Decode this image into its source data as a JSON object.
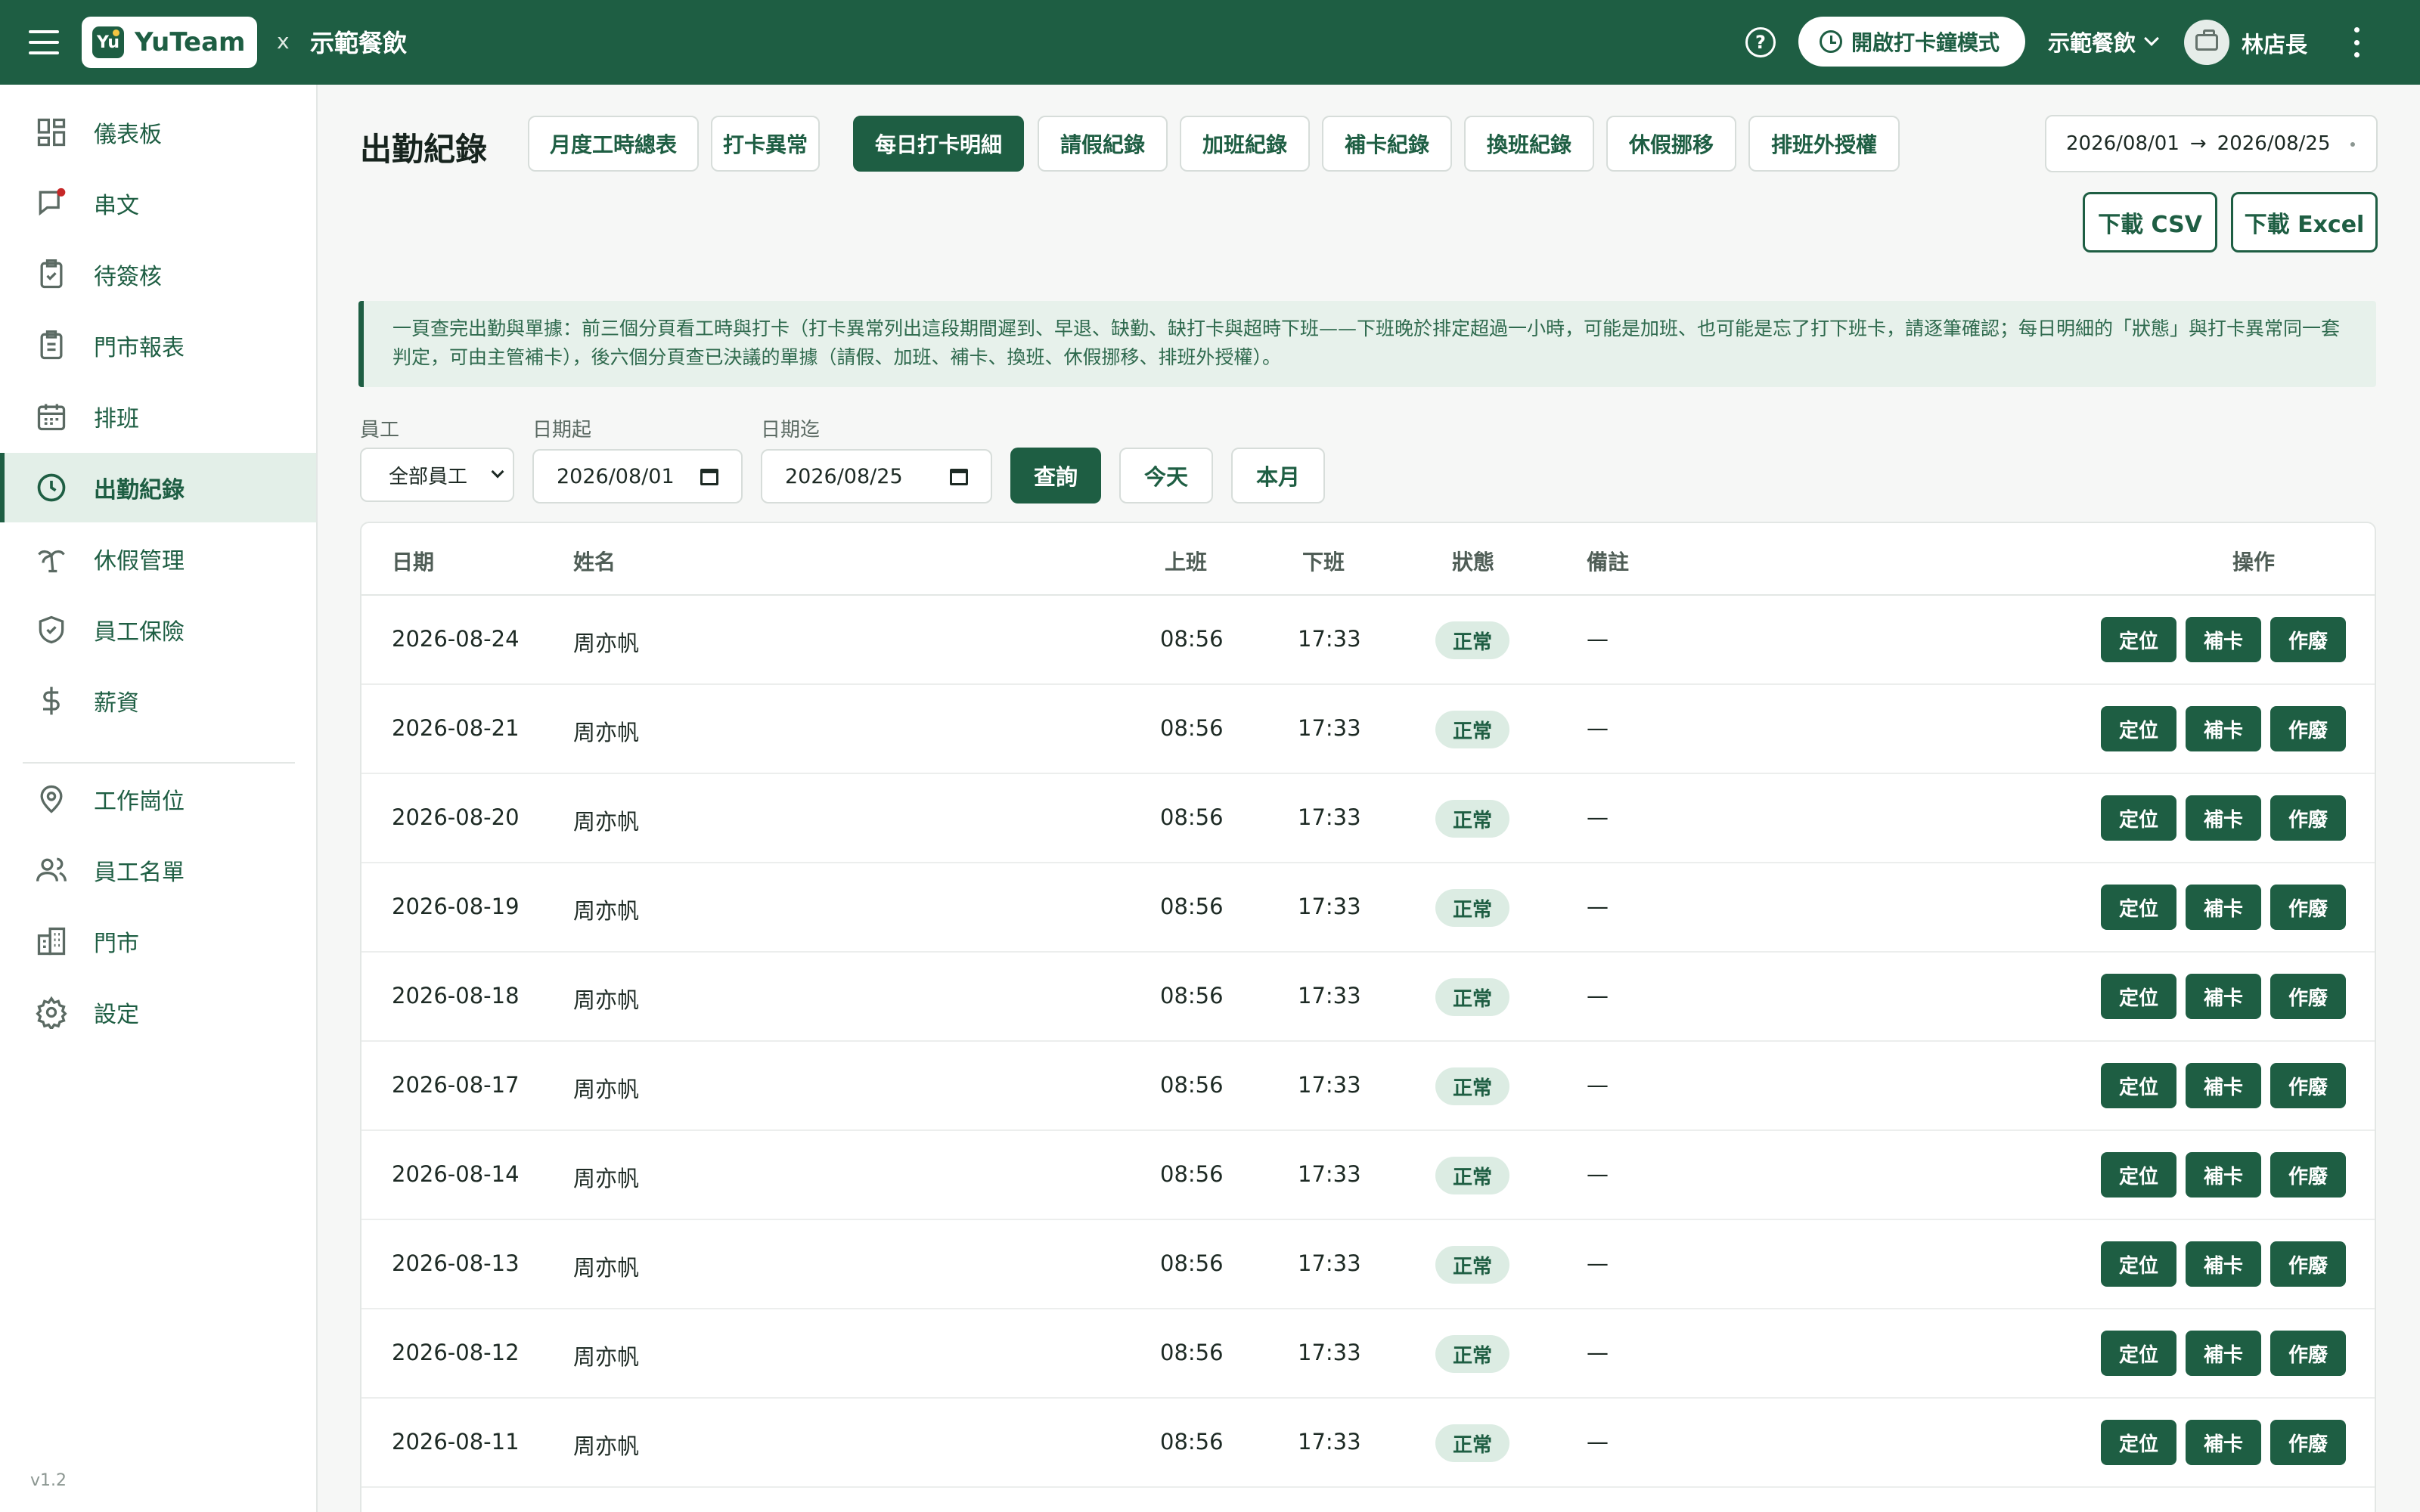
{
  "topbar": {
    "logo_text": "YuTeam",
    "logo_mark": "Yu",
    "separator": "x",
    "org_name": "示範餐飲",
    "clock_mode_label": "開啟打卡鐘模式",
    "org_select_value": "示範餐飲",
    "user_name": "林店長",
    "icons": [
      "menu-icon",
      "help-icon",
      "clock-icon",
      "chevron-down-icon",
      "briefcase-icon",
      "more-vertical-icon"
    ]
  },
  "sidebar": {
    "items": [
      {
        "label": "儀表板",
        "icon": "dashboard-icon"
      },
      {
        "label": "串文",
        "icon": "chat-icon"
      },
      {
        "label": "待簽核",
        "icon": "clipboard-check-icon"
      },
      {
        "label": "門市報表",
        "icon": "report-icon"
      },
      {
        "label": "排班",
        "icon": "calendar-icon"
      },
      {
        "label": "出勤紀錄",
        "icon": "clock-icon",
        "active": true
      },
      {
        "label": "休假管理",
        "icon": "palm-tree-icon"
      },
      {
        "label": "員工保險",
        "icon": "shield-check-icon"
      },
      {
        "label": "薪資",
        "icon": "dollar-icon"
      },
      {
        "label": "工作崗位",
        "icon": "map-pin-icon"
      },
      {
        "label": "員工名單",
        "icon": "users-icon"
      },
      {
        "label": "門市",
        "icon": "building-icon"
      },
      {
        "label": "設定",
        "icon": "gear-icon"
      }
    ],
    "version": "v1.2"
  },
  "main": {
    "title": "出勤紀錄",
    "tabs": [
      {
        "label": "月度工時總表"
      },
      {
        "label": "打卡異常"
      },
      {
        "label": "每日打卡明細",
        "active": true
      },
      {
        "label": "請假紀錄"
      },
      {
        "label": "加班紀錄"
      },
      {
        "label": "補卡紀錄"
      },
      {
        "label": "換班紀錄"
      },
      {
        "label": "休假挪移"
      },
      {
        "label": "排班外授權"
      }
    ],
    "date_range": {
      "from": "2026/08/01",
      "arrow": "→",
      "to": "2026/08/25"
    },
    "download_csv": "下載 CSV",
    "download_excel": "下載 Excel",
    "notice": "一頁查完出勤與單據：前三個分頁看工時與打卡（打卡異常列出這段期間遲到、早退、缺勤、缺打卡與超時下班——下班晚於排定超過一小時，可能是加班、也可能是忘了打下班卡，請逐筆確認；每日明細的「狀態」與打卡異常同一套判定，可由主管補卡），後六個分頁查已決議的單據（請假、加班、補卡、換班、休假挪移、排班外授權）。",
    "filters": {
      "employee_label": "員工",
      "employee_value": "全部員工",
      "date_from_label": "日期起",
      "date_from_value": "2026/08/01",
      "date_to_label": "日期迄",
      "date_to_value": "2026/08/25",
      "query_btn": "查詢",
      "today_btn": "今天",
      "month_btn": "本月"
    },
    "table": {
      "columns": {
        "date": "日期",
        "name": "姓名",
        "clock_in": "上班",
        "clock_out": "下班",
        "status": "狀態",
        "note": "備註",
        "actions": "操作"
      },
      "action_labels": {
        "locate": "定位",
        "makeup": "補卡",
        "void": "作廢"
      },
      "rows": [
        {
          "date": "2026-08-24",
          "name": "周亦帆",
          "in": "08:56",
          "out": "17:33",
          "status": "正常",
          "note": "—"
        },
        {
          "date": "2026-08-21",
          "name": "周亦帆",
          "in": "08:56",
          "out": "17:33",
          "status": "正常",
          "note": "—"
        },
        {
          "date": "2026-08-20",
          "name": "周亦帆",
          "in": "08:56",
          "out": "17:33",
          "status": "正常",
          "note": "—"
        },
        {
          "date": "2026-08-19",
          "name": "周亦帆",
          "in": "08:56",
          "out": "17:33",
          "status": "正常",
          "note": "—"
        },
        {
          "date": "2026-08-18",
          "name": "周亦帆",
          "in": "08:56",
          "out": "17:33",
          "status": "正常",
          "note": "—"
        },
        {
          "date": "2026-08-17",
          "name": "周亦帆",
          "in": "08:56",
          "out": "17:33",
          "status": "正常",
          "note": "—"
        },
        {
          "date": "2026-08-14",
          "name": "周亦帆",
          "in": "08:56",
          "out": "17:33",
          "status": "正常",
          "note": "—"
        },
        {
          "date": "2026-08-13",
          "name": "周亦帆",
          "in": "08:56",
          "out": "17:33",
          "status": "正常",
          "note": "—"
        },
        {
          "date": "2026-08-12",
          "name": "周亦帆",
          "in": "08:56",
          "out": "17:33",
          "status": "正常",
          "note": "—"
        },
        {
          "date": "2026-08-11",
          "name": "周亦帆",
          "in": "08:56",
          "out": "17:33",
          "status": "正常",
          "note": "—"
        }
      ]
    }
  },
  "colors": {
    "brand": "#1e5e43",
    "badge_bg": "#dcece3",
    "notice_bg": "#e7f1eb",
    "notification_dot": "#c62828"
  }
}
